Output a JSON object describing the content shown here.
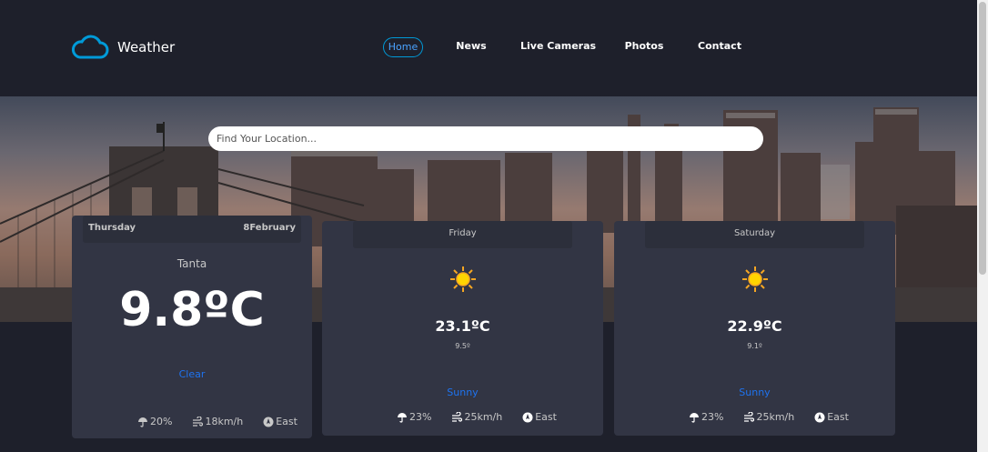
{
  "brand": {
    "name": "Weather"
  },
  "nav": [
    {
      "label": "Home",
      "active": true
    },
    {
      "label": "News",
      "active": false
    },
    {
      "label": "Live Cameras",
      "active": false
    },
    {
      "label": "Photos",
      "active": false
    },
    {
      "label": "Contact",
      "active": false
    }
  ],
  "search": {
    "placeholder": "Find Your Location..."
  },
  "today": {
    "day": "Thursday",
    "date": "8February",
    "city": "Tanta",
    "temp": "9.8ºC",
    "condition": "Clear",
    "rain": "20%",
    "wind": "18km/h",
    "direction": "East"
  },
  "forecast": [
    {
      "day": "Friday",
      "max": "23.1ºC",
      "min": "9.5º",
      "condition": "Sunny",
      "icon": "sun-icon",
      "rain": "23%",
      "wind": "25km/h",
      "direction": "East"
    },
    {
      "day": "Saturday",
      "max": "22.9ºC",
      "min": "9.1º",
      "condition": "Sunny",
      "icon": "sun-icon",
      "rain": "23%",
      "wind": "25km/h",
      "direction": "East"
    }
  ],
  "colors": {
    "background": "#1e202b",
    "card": "#323544",
    "card_header": "#2c2f3b",
    "accent": "#009ad8",
    "condition": "#1e73f0"
  }
}
